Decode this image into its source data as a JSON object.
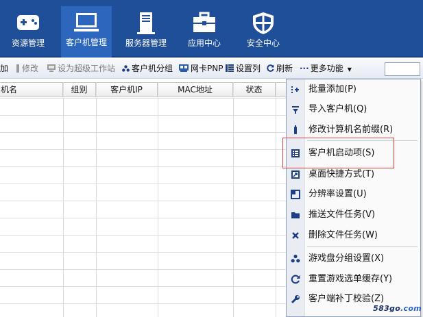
{
  "nav": {
    "items": [
      {
        "label": "资源管理",
        "icon": "gamepad-icon"
      },
      {
        "label": "客户机管理",
        "icon": "monitor-icon",
        "active": true
      },
      {
        "label": "服务器管理",
        "icon": "server-icon"
      },
      {
        "label": "应用中心",
        "icon": "toolbox-icon"
      },
      {
        "label": "安全中心",
        "icon": "shield-icon"
      }
    ],
    "colors": {
      "bar": "#1f4f98",
      "active": "#2d67bd"
    }
  },
  "toolbar": {
    "add": "加",
    "edit": "修改",
    "set_super": "设为超级工作站",
    "client_group": "客户机分组",
    "nic_pnp": "网卡PNP",
    "set_columns": "设置列",
    "refresh": "刷新",
    "more": "更多功能",
    "search_value": ""
  },
  "table": {
    "columns": [
      "机名",
      "组别",
      "客户机IP",
      "MAC地址",
      "状态"
    ]
  },
  "menu": {
    "items": [
      {
        "label": "批量添加(P)",
        "icon": "batch-add-icon"
      },
      {
        "label": "导入客户机(Q)",
        "icon": "import-icon"
      },
      {
        "label": "修改计算机名前缀(R)",
        "icon": "rename-icon"
      },
      {
        "label": "客户机启动项(S)",
        "icon": "startup-list-icon",
        "highlighted": true
      },
      {
        "label": "桌面快捷方式(T)",
        "icon": "shortcut-icon"
      },
      {
        "label": "分辨率设置(U)",
        "icon": "resolution-icon"
      },
      {
        "label": "推送文件任务(V)",
        "icon": "folder-icon"
      },
      {
        "label": "删除文件任务(W)",
        "icon": "delete-icon"
      },
      {
        "label": "游戏盘分组设置(X)",
        "icon": "group-icon"
      },
      {
        "label": "重置游戏选单缓存(Y)",
        "icon": "refresh-icon"
      },
      {
        "label": "客户端补丁校验(Z)",
        "icon": "wrench-icon"
      }
    ],
    "highlight_color": "#e33b3b"
  },
  "watermark": {
    "main": "583go",
    "ext": ".com"
  }
}
